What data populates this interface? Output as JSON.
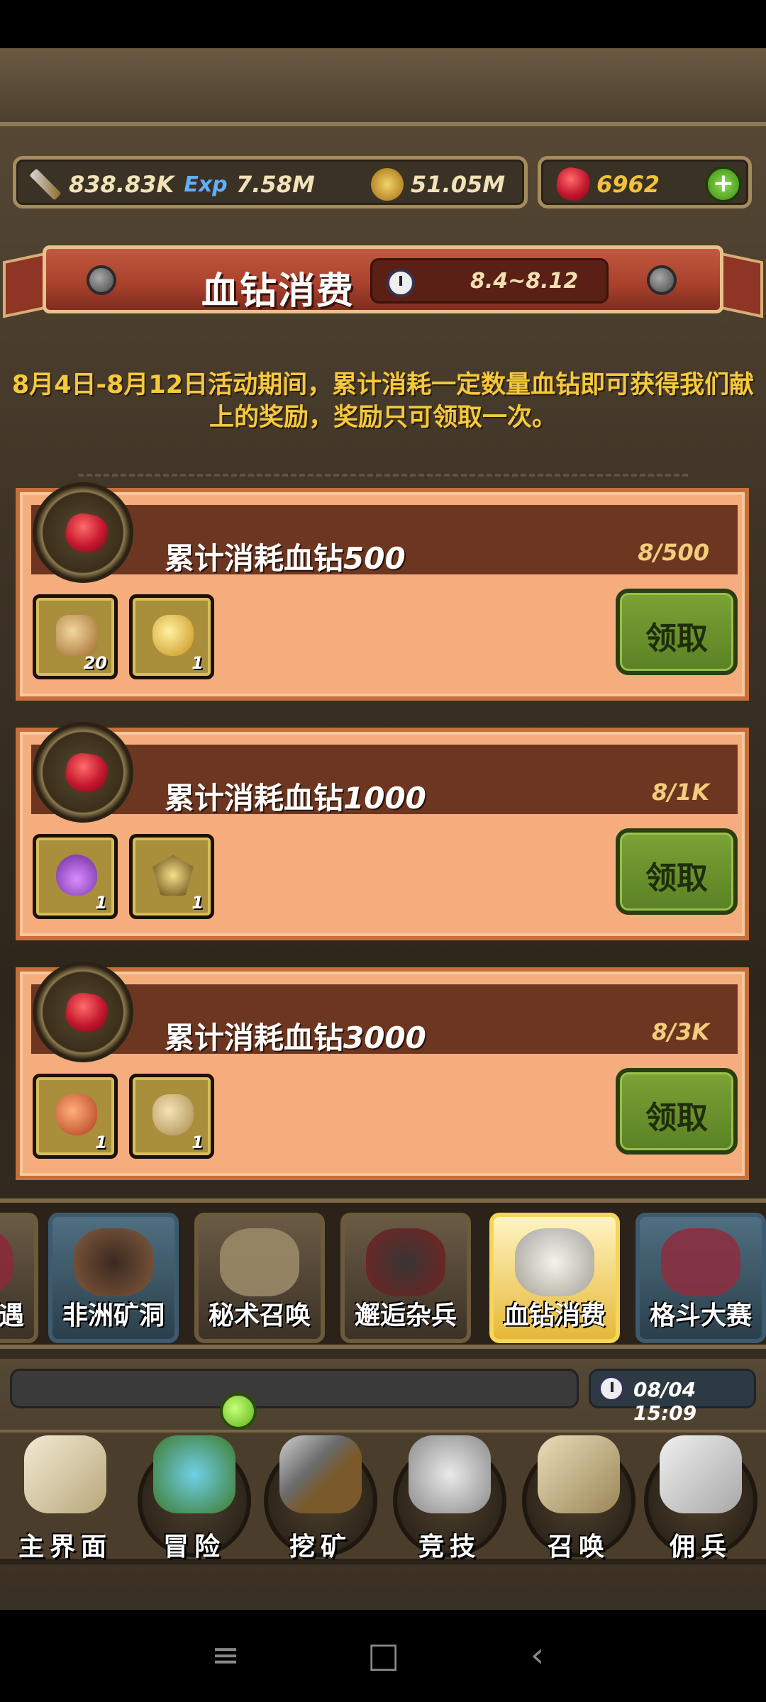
{
  "resources": {
    "attack": "838.83K",
    "exp_icon_label": "Exp",
    "exp": "7.58M",
    "gold": "51.05M",
    "blood_diamond": "6962"
  },
  "event": {
    "title": "血钻消费",
    "date_range": "8.4~8.12",
    "description": "8月4日-8月12日活动期间，累计消耗一定数量血钻即可获得我们献上的奖励，奖励只可领取一次。"
  },
  "rewards": [
    {
      "title_prefix": "累计消耗血钻",
      "title_num": "500",
      "progress": "8/500",
      "items": [
        {
          "icon": "cup-icon",
          "count": "20"
        },
        {
          "icon": "gold-bag-icon",
          "count": "1"
        }
      ],
      "claim_label": "领取"
    },
    {
      "title_prefix": "累计消耗血钻",
      "title_num": "1000",
      "progress": "8/1K",
      "items": [
        {
          "icon": "potion-icon",
          "count": "1"
        },
        {
          "icon": "medal-icon",
          "count": "1"
        }
      ],
      "claim_label": "领取"
    },
    {
      "title_prefix": "累计消耗血钻",
      "title_num": "3000",
      "progress": "8/3K",
      "items": [
        {
          "icon": "red-bag-icon",
          "count": "1"
        },
        {
          "icon": "tan-bag-icon",
          "count": "1"
        }
      ],
      "claim_label": "领取"
    }
  ],
  "activity_tabs": [
    {
      "label": "遇",
      "icon": "encounter-icon"
    },
    {
      "label": "非洲矿洞",
      "icon": "cave-icon"
    },
    {
      "label": "秘术召唤",
      "icon": "scroll-icon"
    },
    {
      "label": "邂逅杂兵",
      "icon": "helmet-icon"
    },
    {
      "label": "血钻消费",
      "icon": "panda-icon",
      "active": true
    },
    {
      "label": "格斗大赛",
      "icon": "ring-icon"
    }
  ],
  "bottom_nav": {
    "timestamp": "08/04 15:09",
    "items": [
      {
        "label": "主界面",
        "icon": "map-scroll-icon"
      },
      {
        "label": "冒险",
        "icon": "island-icon"
      },
      {
        "label": "挖矿",
        "icon": "pickaxe-icon"
      },
      {
        "label": "竞技",
        "icon": "crossed-swords-icon"
      },
      {
        "label": "召唤",
        "icon": "summon-scroll-icon"
      },
      {
        "label": "佣兵",
        "icon": "tent-icon"
      }
    ]
  },
  "colors": {
    "accent_gold": "#f4c93c",
    "card_bg": "#f5ad7d",
    "claim_green": "#6b922c",
    "banner_red": "#a8402c"
  }
}
